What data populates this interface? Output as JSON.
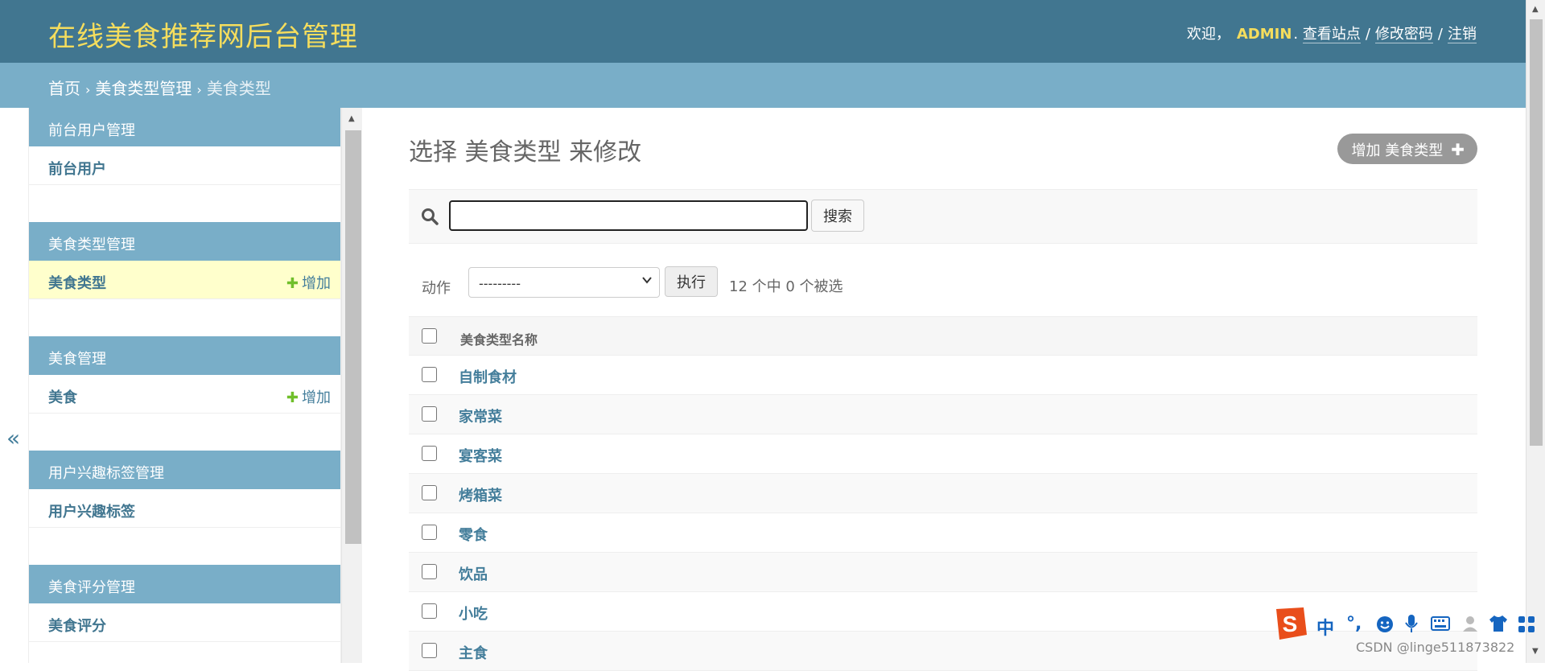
{
  "header": {
    "brand": "在线美食推荐网后台管理",
    "welcome": "欢迎，",
    "username": "ADMIN",
    "view_site": "查看站点",
    "change_password": "修改密码",
    "logout": "注销",
    "sep": "/",
    "bg_color": "#417690",
    "brand_color": "#f5dd5d"
  },
  "breadcrumbs": {
    "home": "首页",
    "app": "美食类型管理",
    "current": "美食类型",
    "sep": "›"
  },
  "sidebar": {
    "toggle": "«",
    "modules": [
      {
        "caption": "前台用户管理",
        "rows": [
          {
            "label": "前台用户",
            "add": ""
          }
        ]
      },
      {
        "caption": "美食类型管理",
        "rows": [
          {
            "label": "美食类型",
            "add": "增加"
          }
        ]
      },
      {
        "caption": "美食管理",
        "rows": [
          {
            "label": "美食",
            "add": "增加"
          }
        ]
      },
      {
        "caption": "用户兴趣标签管理",
        "rows": [
          {
            "label": "用户兴趣标签",
            "add": ""
          }
        ]
      },
      {
        "caption": "美食评分管理",
        "rows": [
          {
            "label": "美食评分",
            "add": ""
          }
        ]
      }
    ],
    "plus": "✚"
  },
  "content": {
    "title": "选择 美食类型 来修改",
    "add_button": "增加 美食类型",
    "add_icon": "✚",
    "search": {
      "value": "",
      "button": "搜索"
    },
    "actions": {
      "label": "动作",
      "selected": "---------",
      "run": "执行",
      "counter": "12 个中 0 个被选"
    },
    "table": {
      "header": "美食类型名称",
      "rows": [
        "自制食材",
        "家常菜",
        "宴客菜",
        "烤箱菜",
        "零食",
        "饮品",
        "小吃",
        "主食"
      ]
    }
  },
  "ime": {
    "mode": "中",
    "punct": "°,"
  },
  "watermark": "CSDN @linge511873822"
}
